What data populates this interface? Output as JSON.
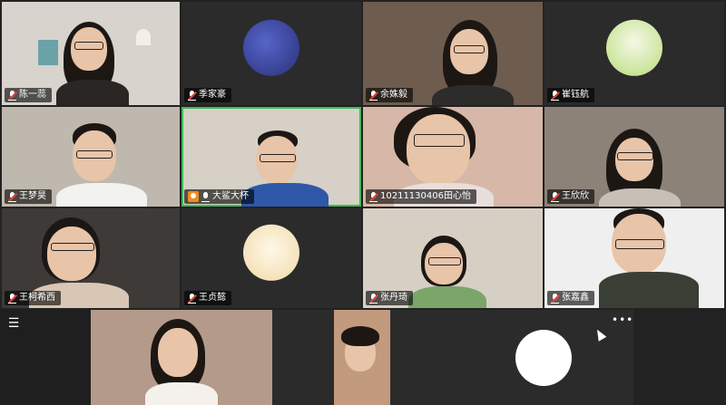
{
  "participants": [
    {
      "name": "陈一蕊"
    },
    {
      "name": "季家豪"
    },
    {
      "name": "余姝毅"
    },
    {
      "name": "崔钰航"
    },
    {
      "name": "王梦昊"
    },
    {
      "name": "大鲨大杯"
    },
    {
      "name": "10211130406田心怡"
    },
    {
      "name": "王欣欣"
    },
    {
      "name": "王柯希西"
    },
    {
      "name": "王贞懿"
    },
    {
      "name": "张丹琦"
    },
    {
      "name": "张嘉鑫"
    }
  ],
  "bottom_row": {
    "more_label": "•••",
    "list_icon": "☰"
  },
  "colors": {
    "active_speaker": "#3cba54",
    "muted": "#e0443a",
    "host": "#f08c1e"
  }
}
